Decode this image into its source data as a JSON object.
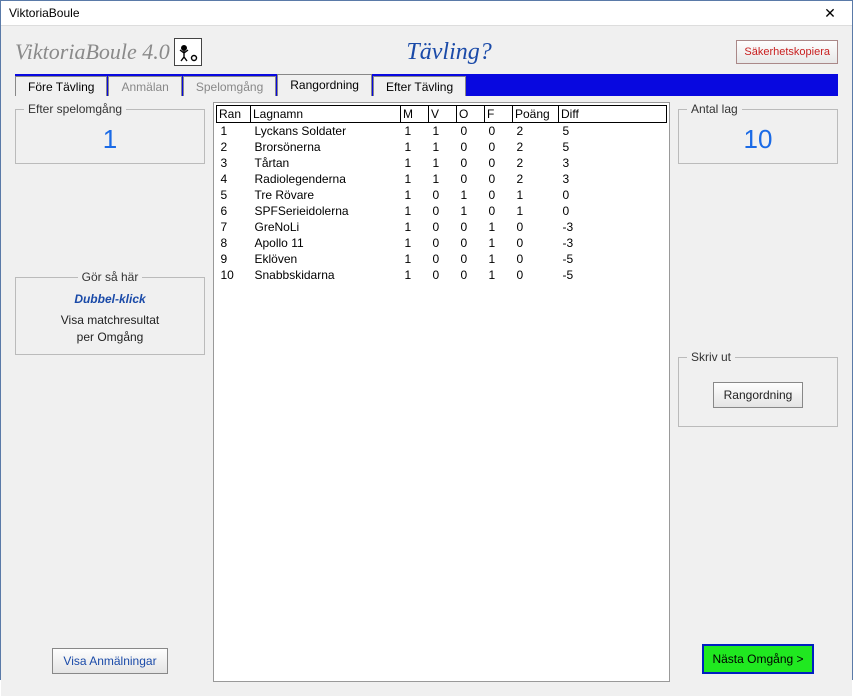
{
  "window": {
    "title": "ViktoriaBoule"
  },
  "header": {
    "app_name": "ViktoriaBoule 4.0",
    "page_title": "Tävling?",
    "backup_label": "Säkerhetskopiera"
  },
  "tabs": {
    "t0": "Före Tävling",
    "t1": "Anmälan",
    "t2": "Spelomgång",
    "t3": "Rangordning",
    "t4": "Efter Tävling"
  },
  "left": {
    "round_legend": "Efter spelomgång",
    "round_value": "1",
    "gor_legend": "Gör så här",
    "gor_title": "Dubbel-klick",
    "gor_line1": "Visa matchresultat",
    "gor_line2": "per Omgång",
    "visa_label": "Visa Anmälningar"
  },
  "right": {
    "antal_legend": "Antal lag",
    "antal_value": "10",
    "skrivut_legend": "Skriv ut",
    "skrivut_btn": "Rangordning",
    "nasta_label": "Nästa Omgång >"
  },
  "table": {
    "headers": {
      "rank": "Ran",
      "team": "Lagnamn",
      "m": "M",
      "v": "V",
      "o": "O",
      "f": "F",
      "p": "Poäng",
      "d": "Diff"
    },
    "rows": [
      {
        "rank": "1",
        "team": "Lyckans Soldater",
        "m": "1",
        "v": "1",
        "o": "0",
        "f": "0",
        "p": "2",
        "d": "5"
      },
      {
        "rank": "2",
        "team": "Brorsönerna",
        "m": "1",
        "v": "1",
        "o": "0",
        "f": "0",
        "p": "2",
        "d": "5"
      },
      {
        "rank": "3",
        "team": "Tårtan",
        "m": "1",
        "v": "1",
        "o": "0",
        "f": "0",
        "p": "2",
        "d": "3"
      },
      {
        "rank": "4",
        "team": "Radiolegenderna",
        "m": "1",
        "v": "1",
        "o": "0",
        "f": "0",
        "p": "2",
        "d": "3"
      },
      {
        "rank": "5",
        "team": "Tre Rövare",
        "m": "1",
        "v": "0",
        "o": "1",
        "f": "0",
        "p": "1",
        "d": "0"
      },
      {
        "rank": "6",
        "team": "SPFSerieidolerna",
        "m": "1",
        "v": "0",
        "o": "1",
        "f": "0",
        "p": "1",
        "d": "0"
      },
      {
        "rank": "7",
        "team": "GreNoLi",
        "m": "1",
        "v": "0",
        "o": "0",
        "f": "1",
        "p": "0",
        "d": "-3"
      },
      {
        "rank": "8",
        "team": "Apollo 11",
        "m": "1",
        "v": "0",
        "o": "0",
        "f": "1",
        "p": "0",
        "d": "-3"
      },
      {
        "rank": "9",
        "team": "Eklöven",
        "m": "1",
        "v": "0",
        "o": "0",
        "f": "1",
        "p": "0",
        "d": "-5"
      },
      {
        "rank": "10",
        "team": "Snabbskidarna",
        "m": "1",
        "v": "0",
        "o": "0",
        "f": "1",
        "p": "0",
        "d": "-5"
      }
    ]
  }
}
